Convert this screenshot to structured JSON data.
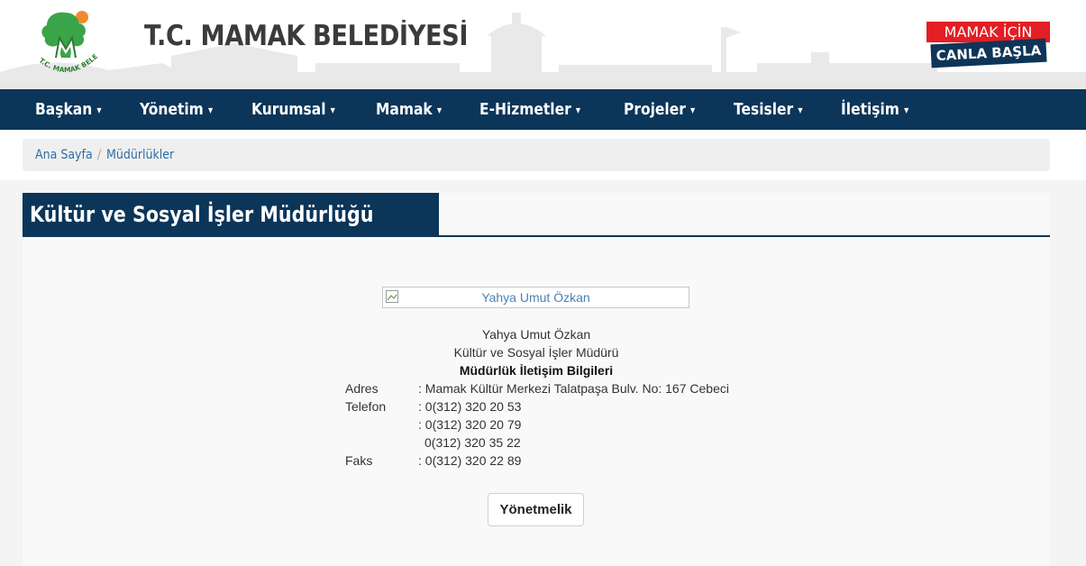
{
  "header": {
    "site_title": "T.C. MAMAK BELEDİYESİ",
    "logo_text": "T.C. MAMAK BELEDİYESİ",
    "slogan_top": "MAMAK İÇİN",
    "slogan_bottom": "CANLA BAŞLA",
    "colors": {
      "navy": "#0b3559",
      "red": "#e31e24",
      "green": "#2e9b3a"
    }
  },
  "nav": {
    "items": [
      {
        "label": "Başkan"
      },
      {
        "label": "Yönetim"
      },
      {
        "label": "Kurumsal"
      },
      {
        "label": "Mamak"
      },
      {
        "label": "E-Hizmetler"
      },
      {
        "label": "Projeler"
      },
      {
        "label": "Tesisler"
      },
      {
        "label": "İletişim"
      }
    ],
    "caret": "▾"
  },
  "breadcrumb": {
    "home": "Ana Sayfa",
    "separator": "/",
    "current": "Müdürlükler"
  },
  "page": {
    "heading": "Kültür ve Sosyal İşler Müdürlüğü",
    "photo_alt": "Yahya Umut Özkan",
    "name": "Yahya Umut Özkan",
    "role": "Kültür ve Sosyal İşler Müdürü",
    "contact_title": "Müdürlük İletişim Bilgileri",
    "contact": {
      "address_label": "Adres",
      "address_value": ": Mamak Kültür Merkezi Talatpaşa Bulv. No: 167 Cebeci",
      "phone_label": "Telefon",
      "phone_1": ": 0(312) 320 20 53",
      "phone_2": ": 0(312) 320 20 79",
      "phone_3": "0(312) 320 35 22",
      "fax_label": "Faks",
      "fax_value": ": 0(312) 320 22 89"
    },
    "button_label": "Yönetmelik"
  }
}
